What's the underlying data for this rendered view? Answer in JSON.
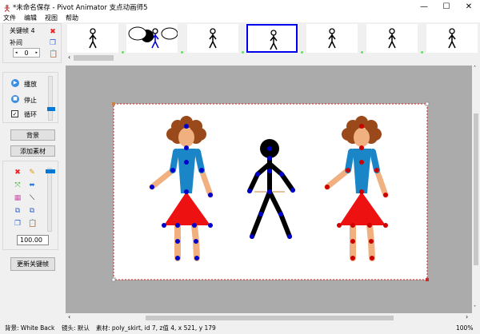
{
  "window": {
    "title": "*未命名保存 - Pivot Animator 支点动画师5",
    "minimize": "—",
    "maximize": "☐",
    "close": "✕"
  },
  "menu": [
    "文件",
    "编辑",
    "视图",
    "帮助"
  ],
  "keyframe": {
    "label": "关键帧 4",
    "tween_label": "补间",
    "tween_value": "0"
  },
  "playback": {
    "play": "播放",
    "stop": "停止",
    "loop": "循环",
    "loop_checked": true
  },
  "buttons": {
    "background": "背景",
    "add_sprite": "添加素材",
    "update_keyframe": "更新关键帧"
  },
  "scale_value": "100.00",
  "frames": {
    "count_visible": 7,
    "selected_index": 3
  },
  "status": {
    "background": "背景: White Back",
    "camera": "镜头: 默认",
    "sprite": "素材: poly_skirt,  id 7,  z值 4,  x 521, y 179",
    "zoom": "100%"
  },
  "colors": {
    "selection": "#0000ee",
    "canvas_border": "#cc2222",
    "joint_blue": "#0000cc",
    "joint_red": "#cc0000",
    "shirt": "#1a86c8",
    "skirt": "#ee1111",
    "skin": "#f0b080",
    "hair": "#9a4a1a"
  }
}
